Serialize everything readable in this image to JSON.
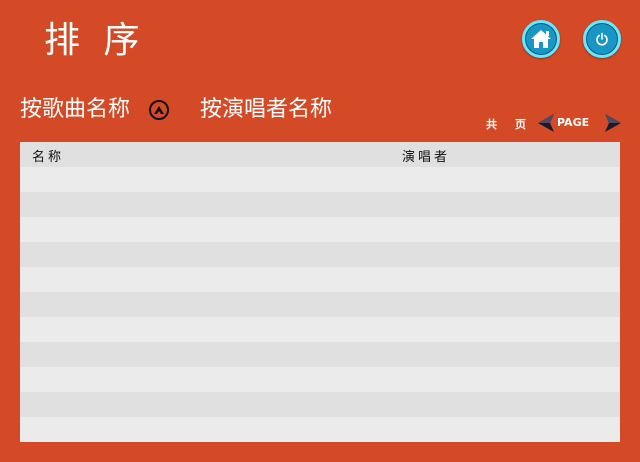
{
  "header": {
    "title": "排 序"
  },
  "sort": {
    "by_song_name": "按歌曲名称",
    "by_singer_name": "按演唱者名称"
  },
  "pager": {
    "total_prefix": "共",
    "total_suffix": "页",
    "page_label": "PAGE"
  },
  "table": {
    "columns": [
      "名称",
      "演唱者"
    ],
    "rows": [
      {
        "name": "",
        "singer": ""
      },
      {
        "name": "",
        "singer": ""
      },
      {
        "name": "",
        "singer": ""
      },
      {
        "name": "",
        "singer": ""
      },
      {
        "name": "",
        "singer": ""
      },
      {
        "name": "",
        "singer": ""
      },
      {
        "name": "",
        "singer": ""
      },
      {
        "name": "",
        "singer": ""
      },
      {
        "name": "",
        "singer": ""
      },
      {
        "name": "",
        "singer": ""
      },
      {
        "name": "",
        "singer": ""
      }
    ]
  },
  "icons": {
    "home": "home-icon",
    "power": "power-icon",
    "sort_ascending": "sort-ascending-icon",
    "prev_page": "arrow-left-icon",
    "next_page": "arrow-right-icon"
  },
  "colors": {
    "background": "#d44a26",
    "accent": "#1a96c4",
    "table_row_light": "#ebebeb",
    "table_row_dark": "#e0e0e0"
  }
}
